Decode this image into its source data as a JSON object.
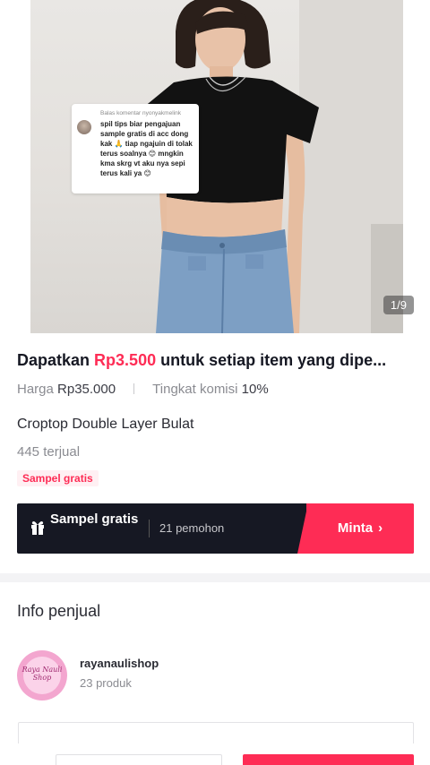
{
  "product_image": {
    "counter": "1/9"
  },
  "comment_bubble": {
    "reply_label": "Balas komentar nyonyakmelink",
    "text": "spil tips biar pengajuan sample gratis di acc dong kak 🙏 tiap ngajuin di tolak terus soalnya 😊 mngkin kma skrg vt aku nya sepi terus kali ya 😊"
  },
  "offer": {
    "prefix": "Dapatkan",
    "amount": "Rp3.500",
    "suffix": "untuk setiap item yang dipe..."
  },
  "pricing": {
    "price_label": "Harga",
    "price_value": "Rp35.000",
    "commission_label": "Tingkat komisi",
    "commission_value": "10%"
  },
  "product": {
    "name": "Croptop Double Layer Bulat",
    "sold": "445 terjual",
    "free_sample_tag": "Sampel gratis"
  },
  "sample_bar": {
    "icon": "gift-icon",
    "label": "Sampel gratis",
    "applicants": "21 pemohon",
    "request_button": "Minta",
    "chevron": "›"
  },
  "seller": {
    "section_title": "Info penjual",
    "name": "rayanaulishop",
    "products": "23 produk",
    "logo_text": "Raya Nauli Shop"
  },
  "colors": {
    "accent": "#fe2c55",
    "dark": "#161823",
    "muted": "#8a8b91"
  }
}
